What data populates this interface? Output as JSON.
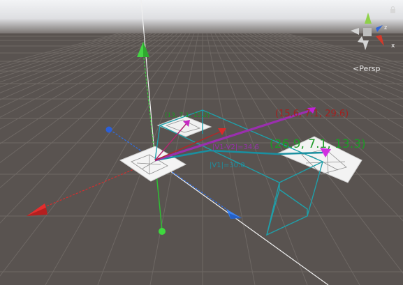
{
  "view": {
    "projection_label": "Persp",
    "camera_icon": "perspective-camera-icon",
    "lock_icon": "padlock-icon"
  },
  "gizmo": {
    "axis_labels": {
      "x": "x",
      "z": "z"
    },
    "colors": {
      "x": "#d33a2b",
      "y": "#7ccd3c",
      "z": "#3467d6",
      "neutral": "#d8d8d8"
    }
  },
  "annotations": {
    "point_a": "(15.6, 7.1, 29.6)",
    "point_b": "(26.9, 7.1, 13.3)",
    "point_c": "(13, 7.1, 15.2)",
    "dist_purple": "|V1-V2|=34.6",
    "dist_teal": "|V1|=30.0"
  },
  "colors": {
    "sky_top": "#e9ecef",
    "ground": "#595350",
    "grid": "#6b6561",
    "teal": "#1d9fa8",
    "purple": "#9a2fae",
    "red_label": "#a3201f",
    "green_label": "#179a24",
    "x_axis": "#e12c2c",
    "y_axis": "#43d143",
    "z_axis": "#2c74ee"
  }
}
